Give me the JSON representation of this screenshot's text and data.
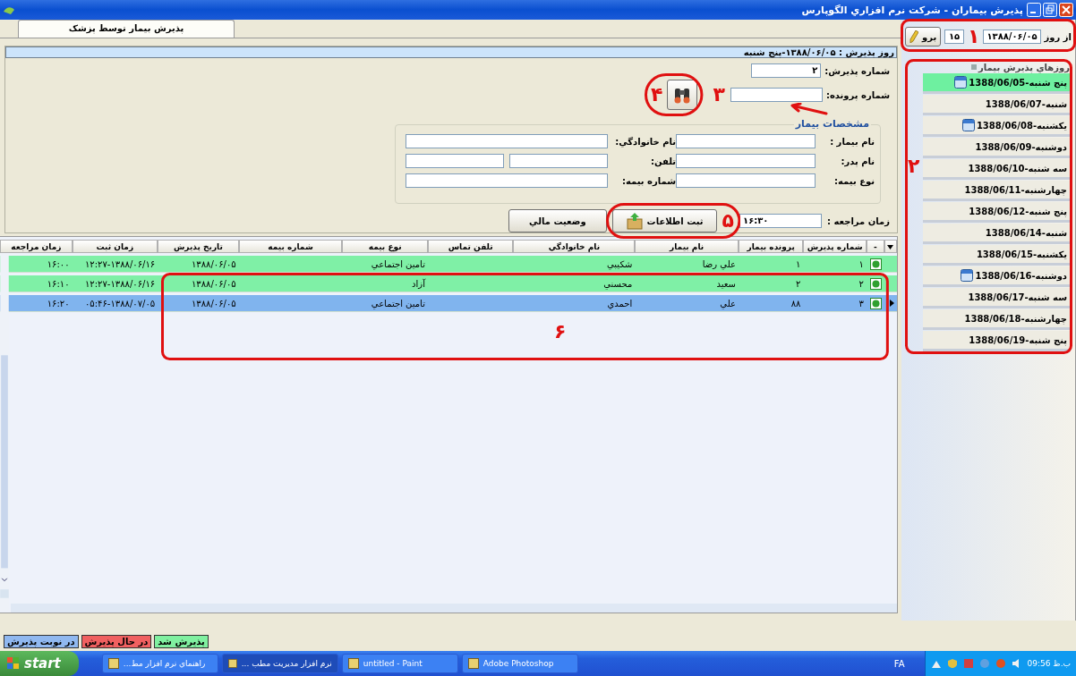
{
  "window": {
    "title": "پذيرش بيماران - شرکت نرم افزاري الگوپارس"
  },
  "tabs": [
    {
      "label": "پذيرش بيمار توسط پزشک",
      "selected": true
    }
  ],
  "date_filter": {
    "label": "از روز",
    "date": "۱۳۸۸/۰۶/۰۵",
    "count": "۱۵",
    "go_button": "برو"
  },
  "days": {
    "title": "روزهاي پذيرش بيمار",
    "items": [
      {
        "label": "پنج شنبه-1388/06/05",
        "icon": true,
        "selected": true
      },
      {
        "label": "شنبه-1388/06/07",
        "icon": false,
        "selected": false
      },
      {
        "label": "يکشنبه-1388/06/08",
        "icon": true,
        "selected": false
      },
      {
        "label": "دوشنبه-1388/06/09",
        "icon": false,
        "selected": false
      },
      {
        "label": "سه شنبه-1388/06/10",
        "icon": false,
        "selected": false
      },
      {
        "label": "چهارشنبه-1388/06/11",
        "icon": false,
        "selected": false
      },
      {
        "label": "پنج شنبه-1388/06/12",
        "icon": false,
        "selected": false
      },
      {
        "label": "شنبه-1388/06/14",
        "icon": false,
        "selected": false
      },
      {
        "label": "يکشنبه-1388/06/15",
        "icon": false,
        "selected": false
      },
      {
        "label": "دوشنبه-1388/06/16",
        "icon": true,
        "selected": false
      },
      {
        "label": "سه شنبه-1388/06/17",
        "icon": false,
        "selected": false
      },
      {
        "label": "چهارشنبه-1388/06/18",
        "icon": false,
        "selected": false
      },
      {
        "label": "پنج شنبه-1388/06/19",
        "icon": false,
        "selected": false
      }
    ]
  },
  "form": {
    "day_header": "روز پذيرش : ۱۳۸۸/۰۶/۰۵-پنج شنبه",
    "admission_number": {
      "label": "شماره پذيرش:",
      "value": "۲"
    },
    "file_number": {
      "label": "شماره پرونده:"
    },
    "group_title": "مشخصات بيمار",
    "fields": [
      {
        "label": "نام بيمار :"
      },
      {
        "label": "نام خانوادگي:"
      },
      {
        "label": "نام پدر:"
      },
      {
        "label": "تلفن:",
        "kind": "double"
      },
      {
        "label": "نوع بيمه:"
      },
      {
        "label": "شماره بيمه:"
      }
    ],
    "visit_time": {
      "label": "زمان مراجعه :",
      "value": "۱۶:۳۰"
    },
    "save_button": "ثبت اطلاعات",
    "finance_button": "وضعيت مالي"
  },
  "table": {
    "columns": [
      "-",
      "شماره پذيرش",
      "پرونده بيمار",
      "نام بيمار",
      "نام خانوادگي",
      "تلفن تماس",
      "نوع بيمه",
      "شماره بيمه",
      "تاريخ پذيرش",
      "زمان ثبت",
      "زمان مراجعه"
    ],
    "rows": [
      {
        "color": "#7ff0a6",
        "selected": false,
        "cells": [
          "",
          "۱",
          "۱",
          "علي رضا",
          "شکيبي",
          "",
          "تامين اجتماعي",
          "",
          "۱۳۸۸/۰۶/۰۵",
          "۱۲:۲۷-۱۳۸۸/۰۶/۱۶",
          "۱۶:۰۰"
        ]
      },
      {
        "color": "#7ff0a6",
        "selected": false,
        "cells": [
          "",
          "۲",
          "۲",
          "سعيد",
          "محسني",
          "",
          "آزاد",
          "",
          "۱۳۸۸/۰۶/۰۵",
          "۱۲:۲۷-۱۳۸۸/۰۶/۱۶",
          "۱۶:۱۰"
        ]
      },
      {
        "color": "#80b4ee",
        "selected": true,
        "cells": [
          "",
          "۳",
          "۸۸",
          "علي",
          "احمدي",
          "",
          "تامين اجتماعي",
          "",
          "۱۳۸۸/۰۶/۰۵",
          "۰۵:۴۶-۱۳۸۸/۰۷/۰۵",
          "۱۶:۲۰"
        ]
      }
    ]
  },
  "legend": [
    {
      "label": "پذيرش شد",
      "color": "#80f0a0"
    },
    {
      "label": "در حال پذيرش",
      "color": "#f06060"
    },
    {
      "label": "در نوبت پذيرش",
      "color": "#90b8f0"
    }
  ],
  "taskbar": {
    "start": "start",
    "items": [
      {
        "label": "Adobe Photoshop",
        "selected": false
      },
      {
        "label": "untitled - Paint",
        "selected": false
      },
      {
        "label": "... نرم افزار مديريت مطب",
        "selected": true
      },
      {
        "label": "...راهنماي نرم افزار مط",
        "selected": false
      }
    ],
    "language": "FA",
    "clock": "09:56 ب.ظ"
  },
  "annotations": [
    {
      "kind": "box",
      "label": "۱"
    },
    {
      "kind": "box",
      "label": "۲"
    },
    {
      "kind": "arrow",
      "label": "۳"
    },
    {
      "kind": "circle",
      "label": "۴"
    },
    {
      "kind": "ellipse",
      "label": "۵"
    },
    {
      "kind": "box",
      "label": "۶"
    }
  ]
}
